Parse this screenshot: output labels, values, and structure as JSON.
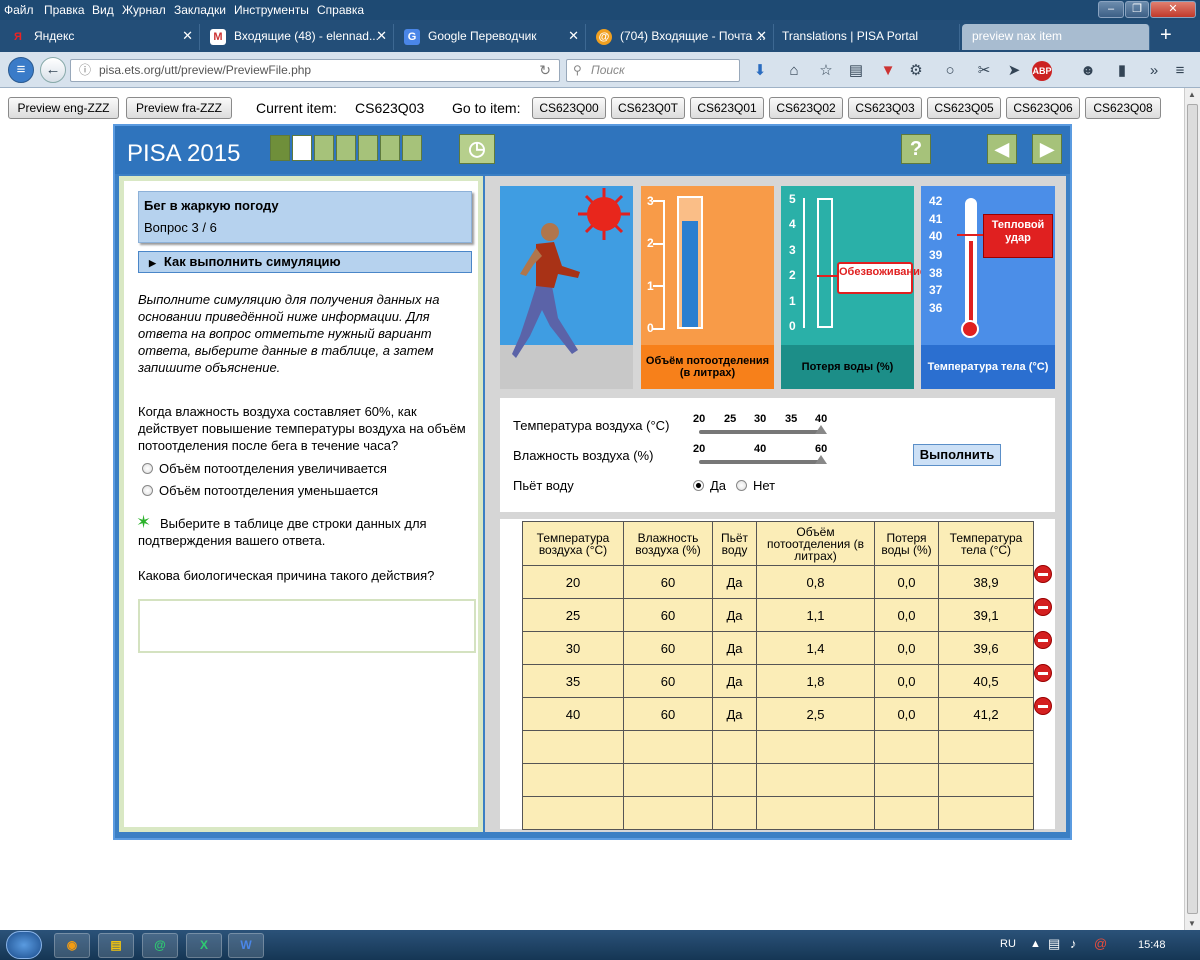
{
  "menubar": {
    "items": [
      "Файл",
      "Правка",
      "Вид",
      "Журнал",
      "Закладки",
      "Инструменты",
      "Справка"
    ]
  },
  "tabs": [
    {
      "label": "Яндекс",
      "icon": "yandex-icon",
      "closable": true
    },
    {
      "label": "Входящие (48) - elennad...",
      "icon": "mail-icon",
      "closable": true
    },
    {
      "label": "Google Переводчик",
      "icon": "google-translate-icon",
      "closable": true
    },
    {
      "label": "(704) Входящие - Почта ...",
      "icon": "mail-at-icon",
      "closable": true
    },
    {
      "label": "Translations | PISA Portal",
      "icon": "",
      "closable": false
    },
    {
      "label": "preview nax item",
      "icon": "",
      "closable": false
    }
  ],
  "nav": {
    "url": "pisa.ets.org/utt/preview/PreviewFile.php",
    "search_placeholder": "Поиск"
  },
  "preview": {
    "buttons": [
      "Preview eng-ZZZ",
      "Preview fra-ZZZ"
    ],
    "current_label": "Current item:",
    "current_value": "CS623Q03",
    "goto_label": "Go to item:",
    "items": [
      "CS623Q00",
      "CS623Q0T",
      "CS623Q01",
      "CS623Q02",
      "CS623Q03",
      "CS623Q05",
      "CS623Q06",
      "CS623Q08"
    ]
  },
  "pisa": {
    "title": "PISA 2015",
    "help_label": "?",
    "unit_title": "Бег в жаркую погоду",
    "question_counter": "Вопрос 3 / 6",
    "howto": "Как выполнить симуляцию",
    "instructions": "Выполните симуляцию для получения данных на основании приведённой ниже информации. Для ответа на вопрос отметьте нужный вариант ответа, выберите данные в таблице, а затем запишите объяснение.",
    "question": "Когда влажность воздуха составляет 60%, как действует повышение температуры воздуха на объём потоотделения после бега в течение часа?",
    "options": [
      "Объём потоотделения увеличивается",
      "Объём потоотделения уменьшается"
    ],
    "select_prompt": "Выберите в таблице две строки данных для подтверждения вашего ответа.",
    "reason_prompt": "Какова биологическая причина такого действия?",
    "sweat_caption": "Объём потоотделения (в литрах)",
    "sweat_ticks": [
      "3",
      "2",
      "1",
      "0"
    ],
    "water_caption": "Потеря воды (%)",
    "water_ticks": [
      "5",
      "4",
      "3",
      "2",
      "1",
      "0"
    ],
    "dehydration": "Обезвоживание",
    "temp_caption": "Температура тела (°C)",
    "temp_ticks": [
      "42",
      "41",
      "40",
      "39",
      "38",
      "37",
      "36"
    ],
    "heatstroke": "Тепловой удар",
    "air_temp_label": "Температура воздуха (°C)",
    "air_temp_ticks": [
      "20",
      "25",
      "30",
      "35",
      "40"
    ],
    "air_temp_value": 40,
    "humidity_label": "Влажность воздуха (%)",
    "humidity_ticks": [
      "20",
      "40",
      "60"
    ],
    "humidity_value": 60,
    "drink_label": "Пьёт воду",
    "drink_yes": "Да",
    "drink_no": "Нет",
    "drink_selected": "Да",
    "run_label": "Выполнить"
  },
  "table": {
    "headers": [
      "Температура воздуха (°C)",
      "Влажность воздуха (%)",
      "Пьёт воду",
      "Объём потоотделения (в литрах)",
      "Потеря воды (%)",
      "Температура тела (°C)"
    ],
    "rows": [
      [
        "20",
        "60",
        "Да",
        "0,8",
        "0,0",
        "38,9"
      ],
      [
        "25",
        "60",
        "Да",
        "1,1",
        "0,0",
        "39,1"
      ],
      [
        "30",
        "60",
        "Да",
        "1,4",
        "0,0",
        "39,6"
      ],
      [
        "35",
        "60",
        "Да",
        "1,8",
        "0,0",
        "40,5"
      ],
      [
        "40",
        "60",
        "Да",
        "2,5",
        "0,0",
        "41,2"
      ],
      [
        "",
        "",
        "",
        "",
        "",
        ""
      ],
      [
        "",
        "",
        "",
        "",
        "",
        ""
      ],
      [
        "",
        "",
        "",
        "",
        "",
        ""
      ]
    ]
  },
  "taskbar": {
    "lang": "RU",
    "time": "15:48"
  }
}
